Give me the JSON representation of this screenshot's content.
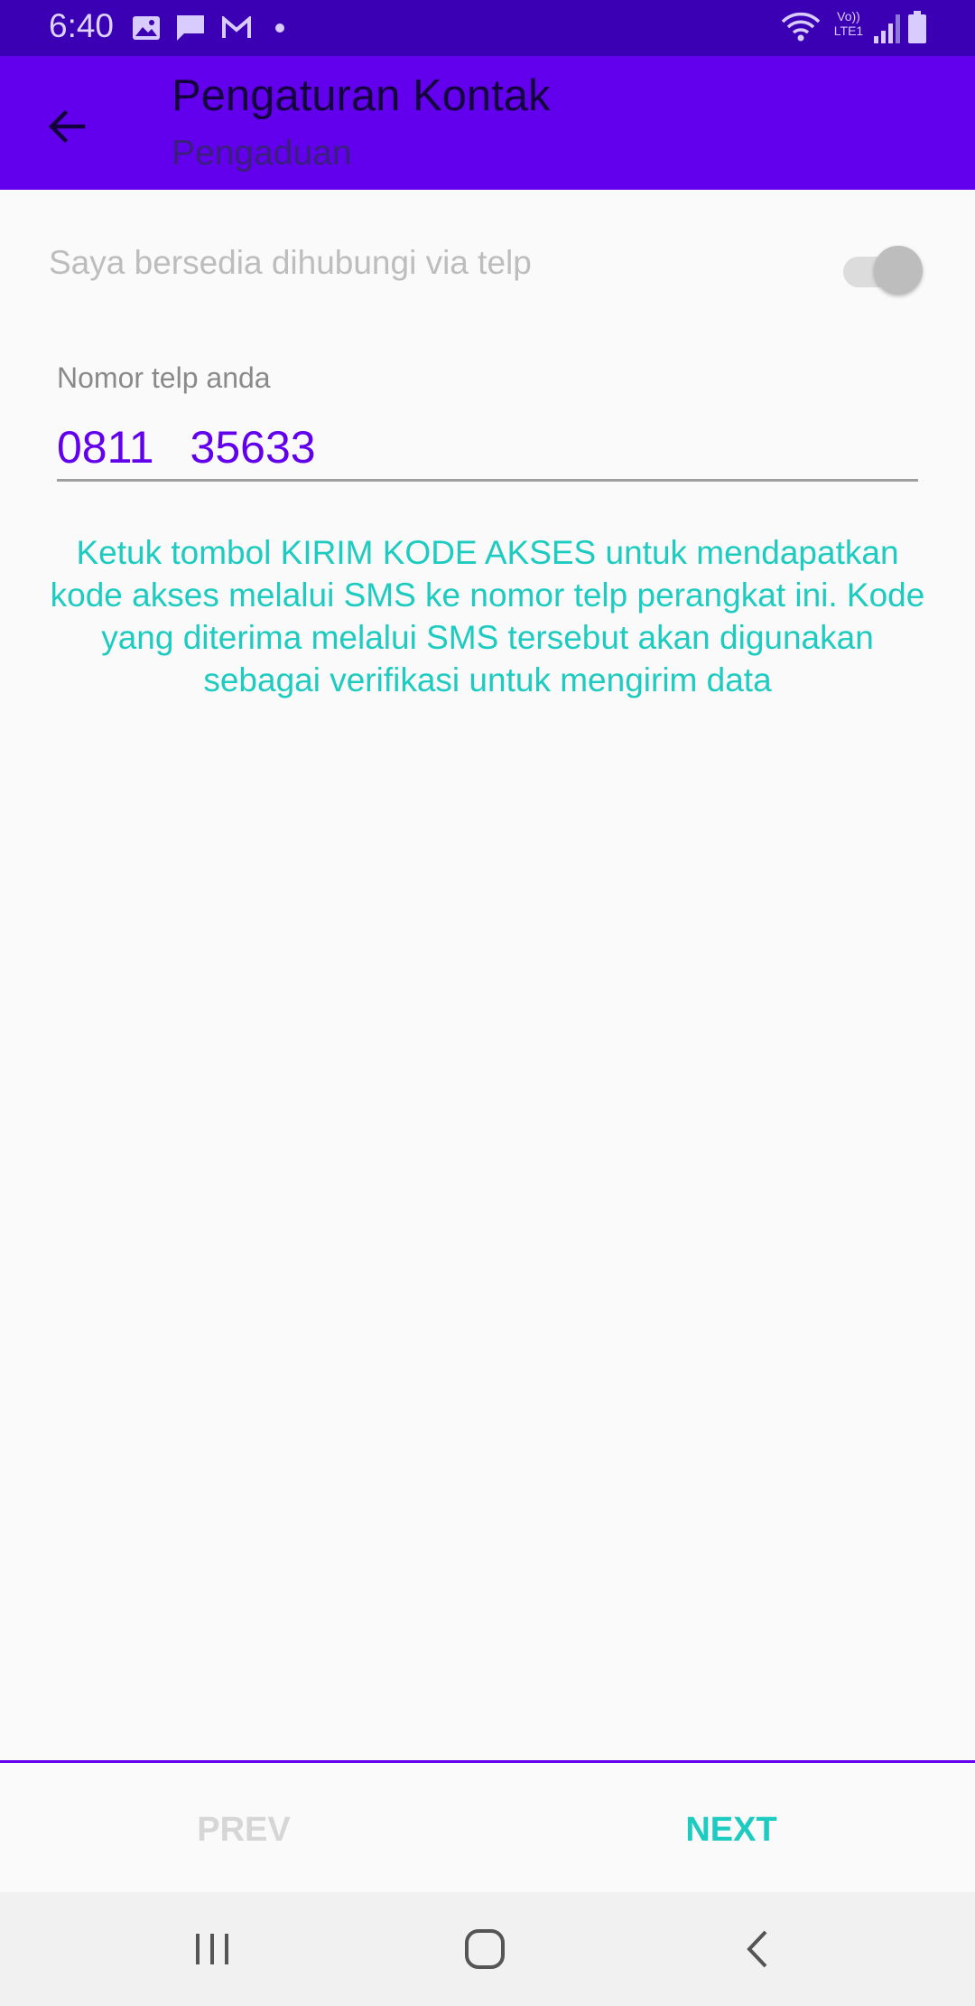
{
  "status_bar": {
    "time": "6:40",
    "network_label": "Vo)) LTE1"
  },
  "app_bar": {
    "title": "Pengaturan Kontak",
    "subtitle": "Pengaduan"
  },
  "contact_toggle": {
    "label": "Saya bersedia dihubungi via telp",
    "enabled": false
  },
  "phone_field": {
    "label": "Nomor telp anda",
    "value": "0811    35633"
  },
  "info_text": "Ketuk tombol KIRIM KODE AKSES untuk mendapatkan kode akses melalui SMS ke nomor telp perangkat ini. Kode yang diterima melalui SMS tersebut akan digunakan sebagai verifikasi untuk mengirim data",
  "navigation": {
    "prev_label": "PREV",
    "next_label": "NEXT"
  },
  "colors": {
    "primary": "#6200ee",
    "status_bar": "#3b00b3",
    "accent": "#1ecbc0"
  }
}
